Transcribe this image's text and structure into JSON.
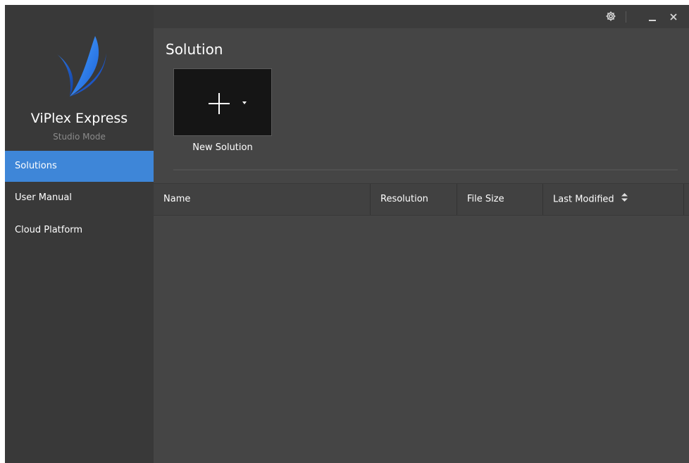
{
  "app": {
    "name": "ViPlex Express",
    "mode": "Studio Mode"
  },
  "sidebar": {
    "items": [
      {
        "label": "Solutions",
        "active": true
      },
      {
        "label": "User Manual",
        "active": false
      },
      {
        "label": "Cloud Platform",
        "active": false
      }
    ]
  },
  "topbar": {
    "icons": [
      "gear-icon",
      "minimize-icon",
      "close-icon"
    ]
  },
  "main": {
    "title": "Solution",
    "new_solution_label": "New Solution",
    "table": {
      "columns": [
        "Name",
        "Resolution",
        "File Size",
        "Last Modified"
      ],
      "rows": []
    }
  },
  "colors": {
    "sidebar_bg": "#393939",
    "main_bg": "#454545",
    "accent": "#3e86d8",
    "tile_bg": "#151515"
  }
}
